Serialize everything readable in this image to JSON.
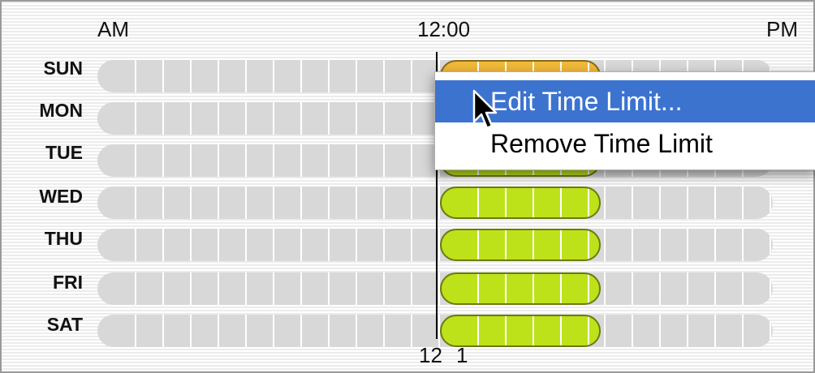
{
  "header": {
    "am": "AM",
    "noon": "12:00",
    "pm": "PM"
  },
  "days": [
    "SUN",
    "MON",
    "TUE",
    "WED",
    "THU",
    "FRI",
    "SAT"
  ],
  "footer": {
    "noon_tick": "12",
    "one_tick": "1"
  },
  "context_menu": {
    "items": [
      {
        "label": "Edit Time Limit...",
        "selected": true
      },
      {
        "label": "Remove Time Limit",
        "selected": false
      }
    ]
  },
  "colors": {
    "limit_weekday": "#bde21a",
    "limit_sunday": "#efb93a",
    "menu_highlight": "#3c73cf",
    "track": "#d8d8d8"
  },
  "icons": {
    "cursor": "arrow-cursor-icon"
  }
}
